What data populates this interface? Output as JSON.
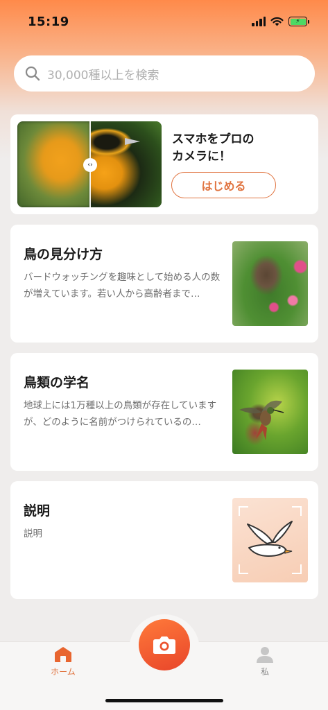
{
  "status_bar": {
    "time": "15:19"
  },
  "search": {
    "placeholder": "30,000種以上を検索"
  },
  "promo": {
    "title_line1": "スマホをプロの",
    "title_line2": "カメラに！",
    "button_label": "はじめる",
    "compare_handle": "‹›"
  },
  "articles": [
    {
      "title": "鳥の見分け方",
      "description": "バードウォッチングを趣味として始める人の数が増えています。若い人から高齢者まで…",
      "image": "sparrow-photo"
    },
    {
      "title": "鳥類の学名",
      "description": "地球上には1万種以上の鳥類が存在していますが、どのように名前がつけられているの…",
      "image": "hummingbird-photo"
    },
    {
      "title": "説明",
      "description": "説明",
      "image": "seagull-illustration"
    }
  ],
  "tab_bar": {
    "home_label": "ホーム",
    "me_label": "私"
  },
  "colors": {
    "accent": "#e0733f",
    "camera_button": "#ee5530",
    "background": "#efedec"
  }
}
